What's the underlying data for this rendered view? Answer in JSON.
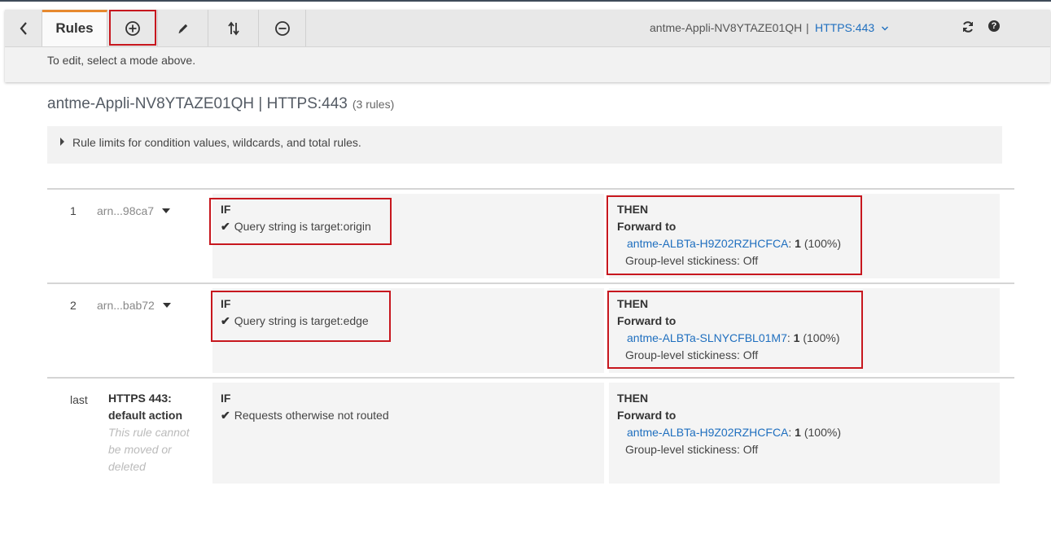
{
  "toolbar": {
    "back_icon": "chevron-left-icon",
    "rules_tab": "Rules",
    "add_icon": "plus-circle-icon",
    "edit_icon": "pencil-icon",
    "reorder_icon": "reorder-arrows-icon",
    "remove_icon": "minus-circle-icon",
    "lb_name": "antme-Appli-NV8YTAZE01QH",
    "separator": "|",
    "listener": "HTTPS:443",
    "refresh_icon": "refresh-icon",
    "help_icon": "question-icon",
    "help_glyph": "?",
    "hint": "To edit, select a mode above."
  },
  "header": {
    "title": "antme-Appli-NV8YTAZE01QH | HTTPS:443",
    "rule_count": "(3 rules)",
    "limits_label": "Rule limits for condition values, wildcards, and total rules."
  },
  "rules": [
    {
      "num": "1",
      "arn": "arn...98ca7",
      "if_label": "IF",
      "condition_prefix": "Query string is",
      "condition_value": "target:origin",
      "then_label": "THEN",
      "action": "Forward to",
      "target_group": "antme-ALBTa-H9Z02RZHCFCA",
      "weight_sep": ":",
      "weight": "1",
      "weight_pct": "(100%)",
      "stickiness": "Group-level stickiness: Off"
    },
    {
      "num": "2",
      "arn": "arn...bab72",
      "if_label": "IF",
      "condition_prefix": "Query string is",
      "condition_value": "target:edge",
      "then_label": "THEN",
      "action": "Forward to",
      "target_group": "antme-ALBTa-SLNYCFBL01M7",
      "weight_sep": ":",
      "weight": "1",
      "weight_pct": "(100%)",
      "stickiness": "Group-level stickiness: Off"
    }
  ],
  "default_rule": {
    "num": "last",
    "title_line1": "HTTPS 443:",
    "title_line2": "default action",
    "note_line1": "This rule cannot",
    "note_line2": "be moved or",
    "note_line3": "deleted",
    "if_label": "IF",
    "condition": "Requests otherwise not routed",
    "then_label": "THEN",
    "action": "Forward to",
    "target_group": "antme-ALBTa-H9Z02RZHCFCA",
    "weight_sep": ":",
    "weight": "1",
    "weight_pct": "(100%)",
    "stickiness": "Group-level stickiness: Off"
  },
  "colors": {
    "accent": "#e7892e",
    "link": "#1f6fbf",
    "highlight": "#c7171e"
  }
}
